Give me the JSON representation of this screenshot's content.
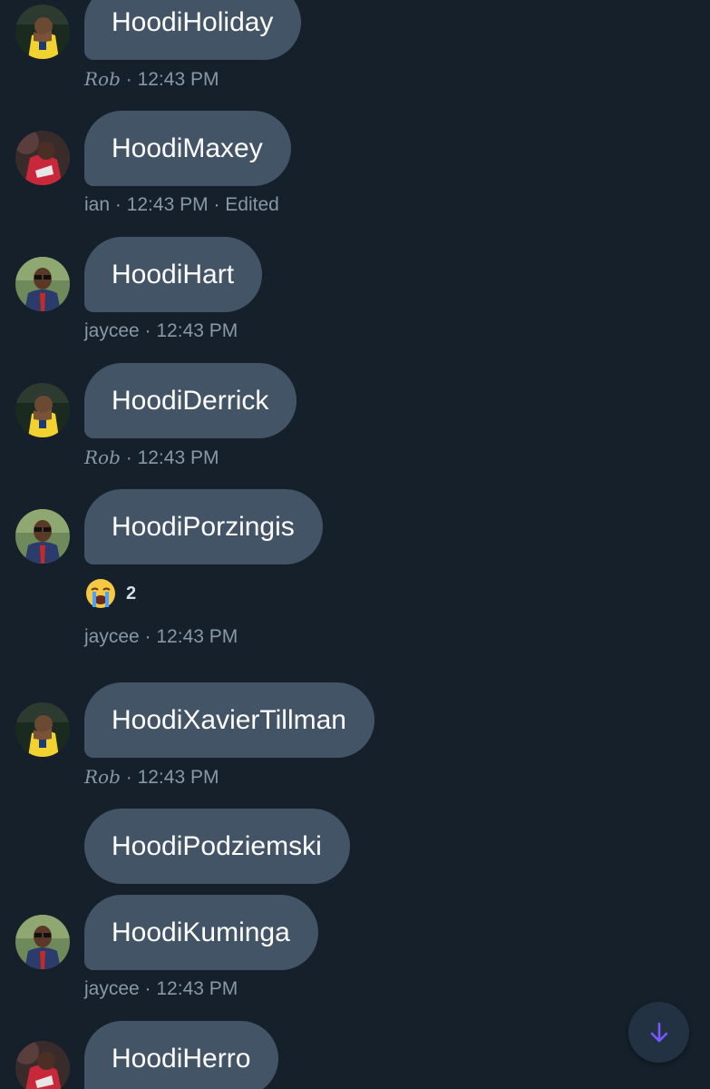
{
  "accent_color": "#7856ff",
  "bubble_color": "#425466",
  "background_color": "#15202b",
  "messages": [
    {
      "text": "HoodiHoliday",
      "sender": "Rob",
      "time": "· 12:43 PM",
      "edited": "",
      "avatar": "rob-avatar"
    },
    {
      "text": "HoodiMaxey",
      "sender": "ian",
      "time": "· 12:43 PM",
      "edited": "· Edited",
      "avatar": "ian-avatar"
    },
    {
      "text": "HoodiHart",
      "sender": "jaycee",
      "time": "· 12:43 PM",
      "edited": "",
      "avatar": "jaycee-avatar"
    },
    {
      "text": "HoodiDerrick",
      "sender": "Rob",
      "time": "· 12:43 PM",
      "edited": "",
      "avatar": "rob-avatar"
    },
    {
      "text": "HoodiPorzingis",
      "sender": "jaycee",
      "time": "· 12:43 PM",
      "edited": "",
      "avatar": "jaycee-avatar",
      "reaction": {
        "emoji": "😭",
        "count": "2"
      }
    },
    {
      "text": "HoodiXavierTillman",
      "sender": "Rob",
      "time": "· 12:43 PM",
      "edited": "",
      "avatar": "rob-avatar"
    },
    {
      "text": "HoodiPodziemski",
      "sender": "",
      "time": "",
      "edited": "",
      "avatar": ""
    },
    {
      "text": "HoodiKuminga",
      "sender": "jaycee",
      "time": "· 12:43 PM",
      "edited": "",
      "avatar": "jaycee-avatar"
    },
    {
      "text": "HoodiHerro",
      "sender": "",
      "time": "",
      "edited": "",
      "avatar": "ian-avatar"
    }
  ],
  "scroll_button": {
    "icon": "arrow-down-icon"
  }
}
